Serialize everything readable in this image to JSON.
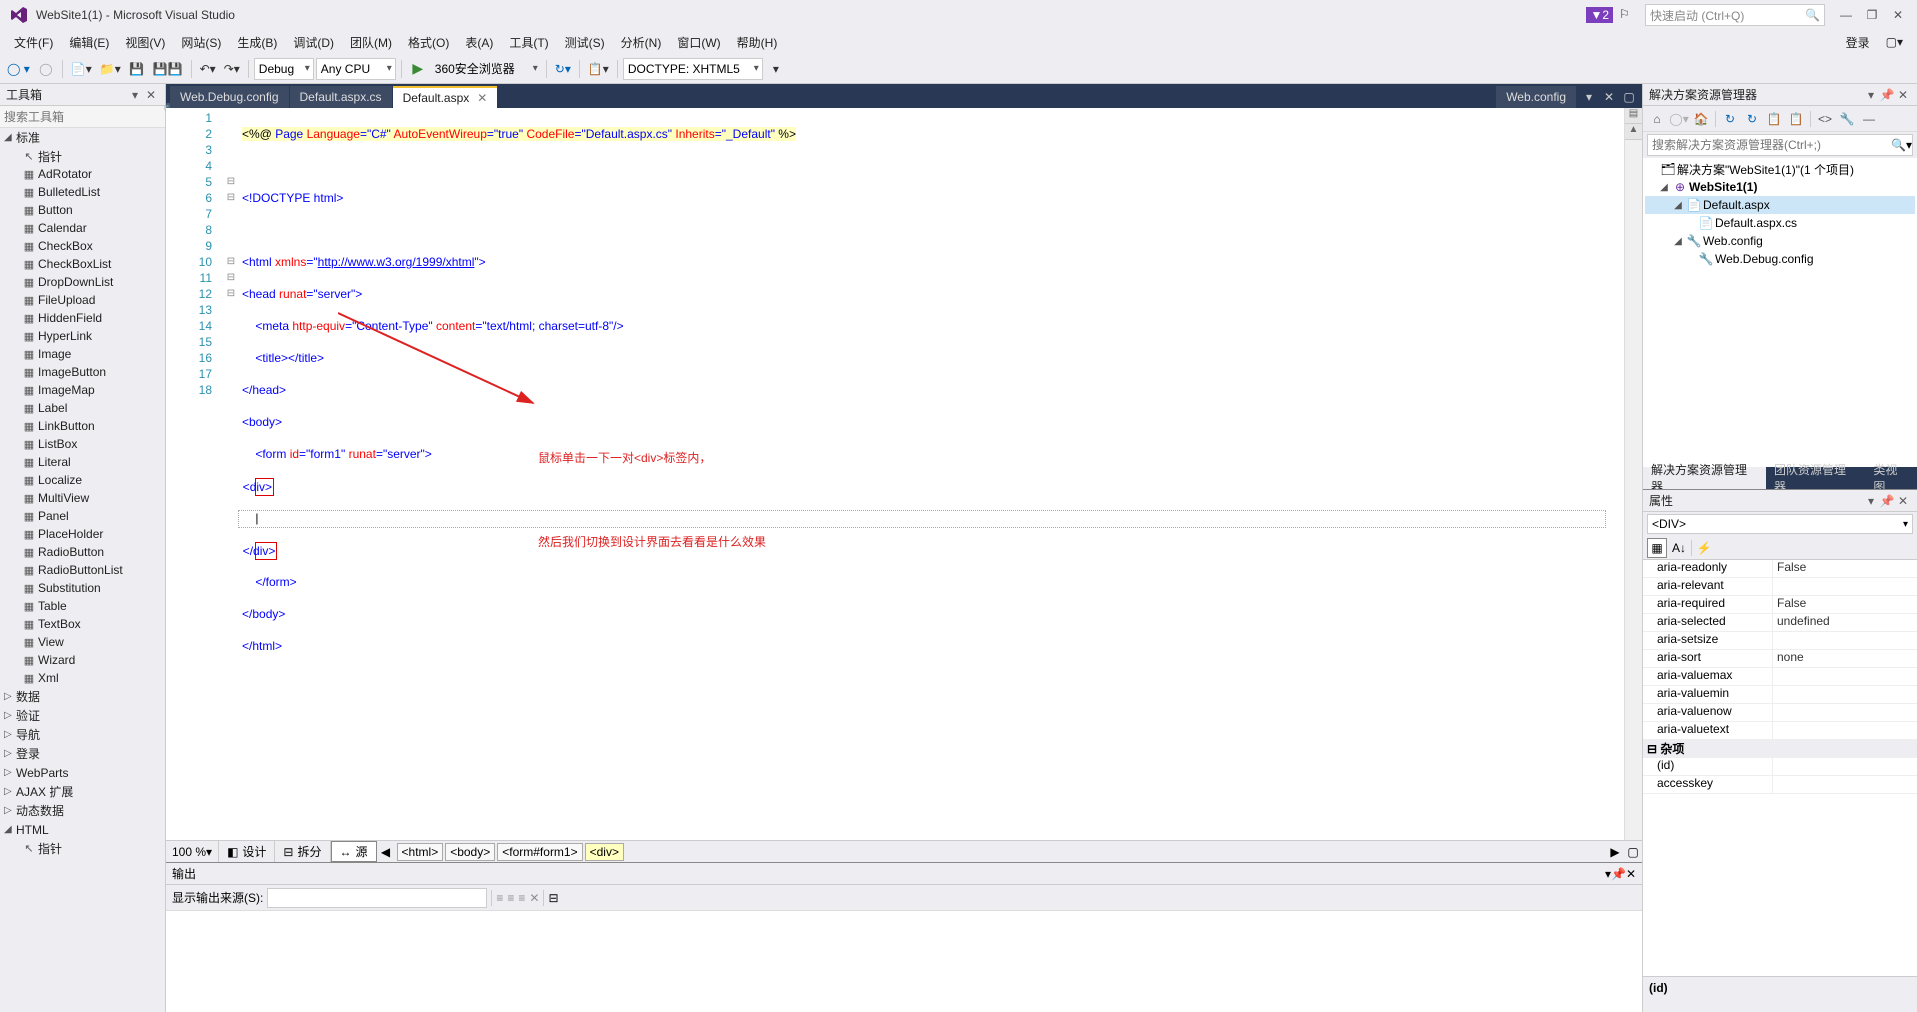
{
  "titlebar": {
    "title": "WebSite1(1) - Microsoft Visual Studio",
    "badge": "▼2",
    "quicklaunch_placeholder": "快速启动 (Ctrl+Q)",
    "login": "登录"
  },
  "menubar": {
    "items": [
      "文件(F)",
      "编辑(E)",
      "视图(V)",
      "网站(S)",
      "生成(B)",
      "调试(D)",
      "团队(M)",
      "格式(O)",
      "表(A)",
      "工具(T)",
      "测试(S)",
      "分析(N)",
      "窗口(W)",
      "帮助(H)"
    ]
  },
  "toolbar": {
    "config": "Debug",
    "cpu": "Any CPU",
    "launch": "360安全浏览器",
    "doctype": "DOCTYPE: XHTML5"
  },
  "toolbox": {
    "title": "工具箱",
    "search_placeholder": "搜索工具箱",
    "categories_expanded": "标准",
    "items": [
      "指针",
      "AdRotator",
      "BulletedList",
      "Button",
      "Calendar",
      "CheckBox",
      "CheckBoxList",
      "DropDownList",
      "FileUpload",
      "HiddenField",
      "HyperLink",
      "Image",
      "ImageButton",
      "ImageMap",
      "Label",
      "LinkButton",
      "ListBox",
      "Literal",
      "Localize",
      "MultiView",
      "Panel",
      "PlaceHolder",
      "RadioButton",
      "RadioButtonList",
      "Substitution",
      "Table",
      "TextBox",
      "View",
      "Wizard",
      "Xml"
    ],
    "categories_collapsed": [
      "数据",
      "验证",
      "导航",
      "登录",
      "WebParts",
      "AJAX 扩展",
      "动态数据"
    ],
    "category_html": "HTML",
    "html_item": "指针"
  },
  "tabs": {
    "inactive": [
      "Web.Debug.config",
      "Default.aspx.cs"
    ],
    "active": "Default.aspx",
    "right": "Web.config"
  },
  "code": {
    "line_count": 18,
    "l1_pre": "<%@ ",
    "l1_page": "Page ",
    "l1_lang_k": "Language",
    "l1_lang_v": "=\"C#\" ",
    "l1_aew_k": "AutoEventWireup",
    "l1_aew_v": "=\"true\" ",
    "l1_cf_k": "CodeFile",
    "l1_cf_v": "=\"Default.aspx.cs\" ",
    "l1_inh_k": "Inherits",
    "l1_inh_v": "=\"_Default\" ",
    "l1_end": "%>",
    "l3": "<!DOCTYPE html>",
    "l5_open": "<html ",
    "l5_attr": "xmlns",
    "l5_eq": "=\"",
    "l5_url": "http://www.w3.org/1999/xhtml",
    "l5_close": "\">",
    "l6_open": "<head ",
    "l6_attr": "runat",
    "l6_val": "=\"server\">",
    "l7_open": "    <meta ",
    "l7_a1": "http-equiv",
    "l7_v1": "=\"Content-Type\" ",
    "l7_a2": "content",
    "l7_v2": "=\"text/html; charset=utf-8\"/>",
    "l8": "    <title></title>",
    "l9": "</head>",
    "l10": "<body>",
    "l11_open": "    <form ",
    "l11_a1": "id",
    "l11_v1": "=\"form1\" ",
    "l11_a2": "runat",
    "l11_v2": "=\"server\">",
    "l12": "    <div>",
    "l13": "    ",
    "l14": "    </div>",
    "l15": "    </form>",
    "l16": "</body>",
    "l17": "</html>"
  },
  "annotation": {
    "line1": "鼠标单击一下一对<div>标签内，",
    "line2": "然后我们切换到设计界面去看看是什么效果"
  },
  "zoombar": {
    "zoom": "100 %",
    "design": "设计",
    "split": "拆分",
    "source": "源",
    "crumbs": [
      "<html>",
      "<body>",
      "<form#form1>"
    ],
    "crumb_active": "<div>"
  },
  "output": {
    "title": "输出",
    "label": "显示输出来源(S):"
  },
  "solexp": {
    "title": "解决方案资源管理器",
    "search_placeholder": "搜索解决方案资源管理器(Ctrl+;)",
    "root": "解决方案\"WebSite1(1)\"(1 个项目)",
    "proj": "WebSite1(1)",
    "file1": "Default.aspx",
    "file1_child": "Default.aspx.cs",
    "file2": "Web.config",
    "file2_child": "Web.Debug.config",
    "tabs": [
      "解决方案资源管理器",
      "团队资源管理器",
      "类视图"
    ]
  },
  "props": {
    "title": "属性",
    "selected": "<DIV>",
    "rows": [
      {
        "k": "aria-readonly",
        "v": "False"
      },
      {
        "k": "aria-relevant",
        "v": ""
      },
      {
        "k": "aria-required",
        "v": "False"
      },
      {
        "k": "aria-selected",
        "v": "undefined"
      },
      {
        "k": "aria-setsize",
        "v": ""
      },
      {
        "k": "aria-sort",
        "v": "none"
      },
      {
        "k": "aria-valuemax",
        "v": ""
      },
      {
        "k": "aria-valuemin",
        "v": ""
      },
      {
        "k": "aria-valuenow",
        "v": ""
      },
      {
        "k": "aria-valuetext",
        "v": ""
      }
    ],
    "cat": "杂项",
    "rows2": [
      {
        "k": "(id)",
        "v": ""
      },
      {
        "k": "accesskey",
        "v": ""
      }
    ],
    "desc_title": "(id)"
  }
}
